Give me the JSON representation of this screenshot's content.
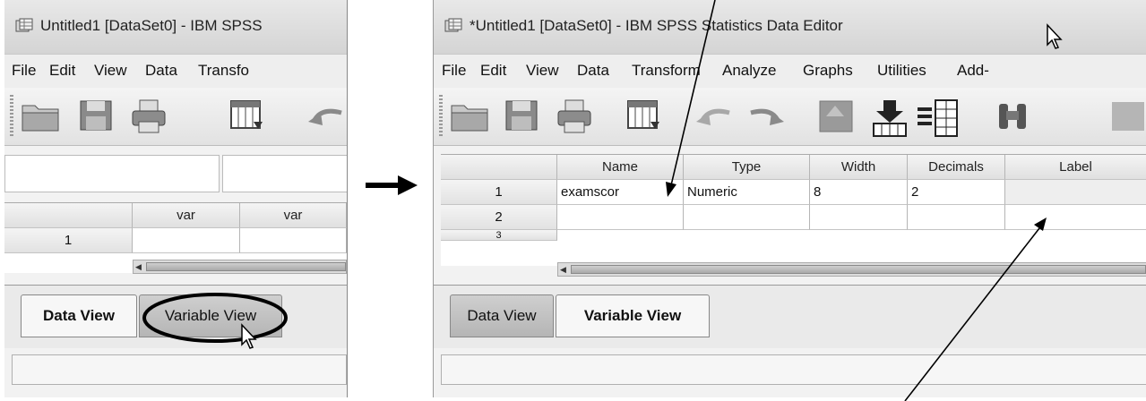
{
  "left_window": {
    "title": "Untitled1 [DataSet0] - IBM SPSS",
    "menu": [
      "File",
      "Edit",
      "View",
      "Data",
      "Transfo"
    ],
    "grid": {
      "columns": [
        "var",
        "var"
      ],
      "rows": [
        "1"
      ]
    },
    "tabs": {
      "data_view": "Data View",
      "variable_view": "Variable View"
    }
  },
  "right_window": {
    "title": "*Untitled1 [DataSet0] - IBM SPSS Statistics Data Editor",
    "menu": [
      "File",
      "Edit",
      "View",
      "Data",
      "Transform",
      "Analyze",
      "Graphs",
      "Utilities",
      "Add-"
    ],
    "grid": {
      "columns": [
        "Name",
        "Type",
        "Width",
        "Decimals",
        "Label"
      ],
      "rows": [
        {
          "num": "1",
          "cells": [
            "examscor",
            "Numeric",
            "8",
            "2",
            ""
          ]
        },
        {
          "num": "2",
          "cells": [
            "",
            "",
            "",
            "",
            ""
          ]
        },
        {
          "num": "3",
          "cells": [
            "",
            "",
            "",
            "",
            ""
          ]
        }
      ]
    },
    "tabs": {
      "data_view": "Data View",
      "variable_view": "Variable View"
    }
  },
  "icons": {
    "open": "open-folder-icon",
    "save": "save-disk-icon",
    "print": "printer-icon",
    "recall": "dialog-recall-icon",
    "undo": "undo-icon",
    "redo": "redo-icon",
    "goto_case": "go-to-case-icon",
    "goto_variable": "go-to-variable-icon",
    "variables": "variables-icon",
    "find": "binoculars-find-icon",
    "app": "spss-app-icon"
  }
}
